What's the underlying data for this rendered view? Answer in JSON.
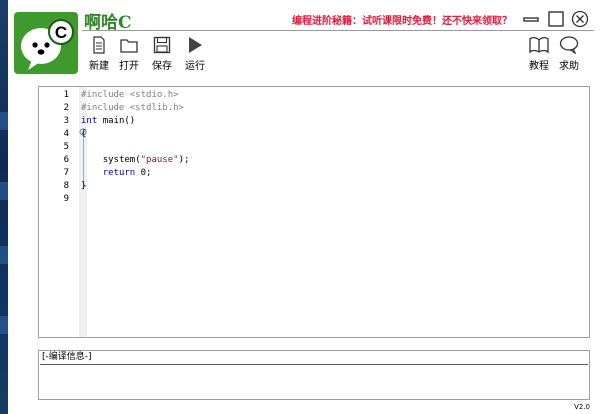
{
  "app": {
    "title": "啊哈C",
    "version": "V2.0",
    "promo": "编程进阶秘籍：试听课限时免费！还不快来领取？"
  },
  "toolbar": {
    "left": [
      {
        "label": "新建",
        "icon": "new-file-icon"
      },
      {
        "label": "打开",
        "icon": "open-folder-icon"
      },
      {
        "label": "保存",
        "icon": "save-icon"
      },
      {
        "label": "运行",
        "icon": "run-icon"
      }
    ],
    "right": [
      {
        "label": "教程",
        "icon": "book-icon"
      },
      {
        "label": "求助",
        "icon": "speech-bubble-icon"
      }
    ]
  },
  "editor": {
    "lines": [
      {
        "num": "1",
        "text": "#include <stdio.h>"
      },
      {
        "num": "2",
        "text": "#include <stdlib.h>"
      },
      {
        "num": "3",
        "text": "int main()"
      },
      {
        "num": "4",
        "text": "{"
      },
      {
        "num": "5",
        "text": ""
      },
      {
        "num": "6",
        "text": "    system(\"pause\");"
      },
      {
        "num": "7",
        "text": "    return 0;"
      },
      {
        "num": "8",
        "text": "}"
      },
      {
        "num": "9",
        "text": ""
      }
    ],
    "colors": {
      "preprocessor": "#808080",
      "keyword": "#00008b",
      "string": "#a31515",
      "number": "#000000",
      "plain": "#000000"
    }
  },
  "compile": {
    "title": "编译信息"
  }
}
